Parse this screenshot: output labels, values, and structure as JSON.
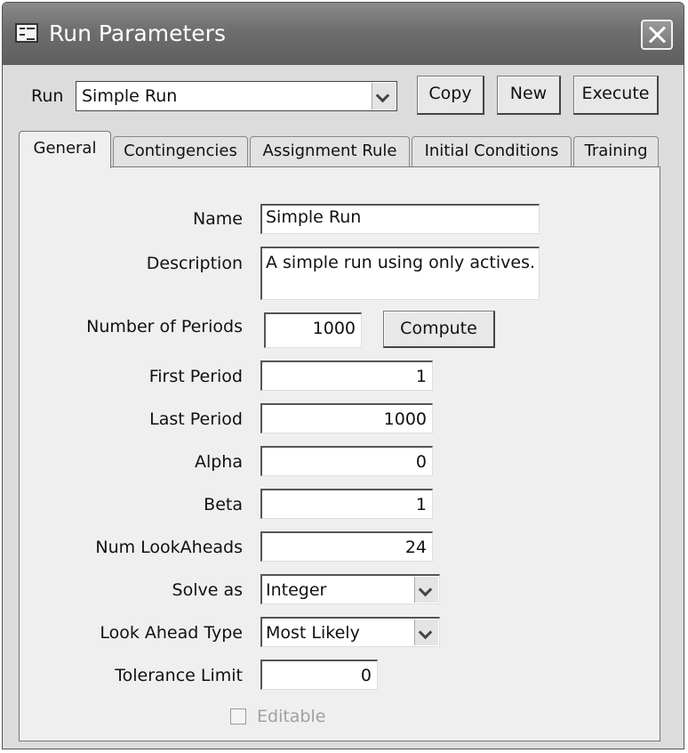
{
  "window": {
    "title": "Run Parameters",
    "icon": "form-icon"
  },
  "run_bar": {
    "label": "Run",
    "selected": "Simple Run",
    "buttons": {
      "copy": "Copy",
      "new": "New",
      "execute": "Execute"
    }
  },
  "tabs": [
    {
      "label": "General",
      "active": true
    },
    {
      "label": "Contingencies",
      "active": false
    },
    {
      "label": "Assignment Rule",
      "active": false
    },
    {
      "label": "Initial Conditions",
      "active": false
    },
    {
      "label": "Training",
      "active": false
    }
  ],
  "general": {
    "name": {
      "label": "Name",
      "value": "Simple Run"
    },
    "description": {
      "label": "Description",
      "value": "A simple run using only actives."
    },
    "number_of_periods": {
      "label": "Number of Periods",
      "value": "1000",
      "button": "Compute"
    },
    "first_period": {
      "label": "First Period",
      "value": "1"
    },
    "last_period": {
      "label": "Last Period",
      "value": "1000"
    },
    "alpha": {
      "label": "Alpha",
      "value": "0"
    },
    "beta": {
      "label": "Beta",
      "value": "1"
    },
    "num_lookaheads": {
      "label": "Num LookAheads",
      "value": "24"
    },
    "solve_as": {
      "label": "Solve as",
      "value": "Integer"
    },
    "look_ahead_type": {
      "label": "Look Ahead Type",
      "value": "Most Likely"
    },
    "tolerance_limit": {
      "label": "Tolerance Limit",
      "value": "0"
    },
    "editable": {
      "label": "Editable",
      "checked": false,
      "enabled": false
    }
  }
}
